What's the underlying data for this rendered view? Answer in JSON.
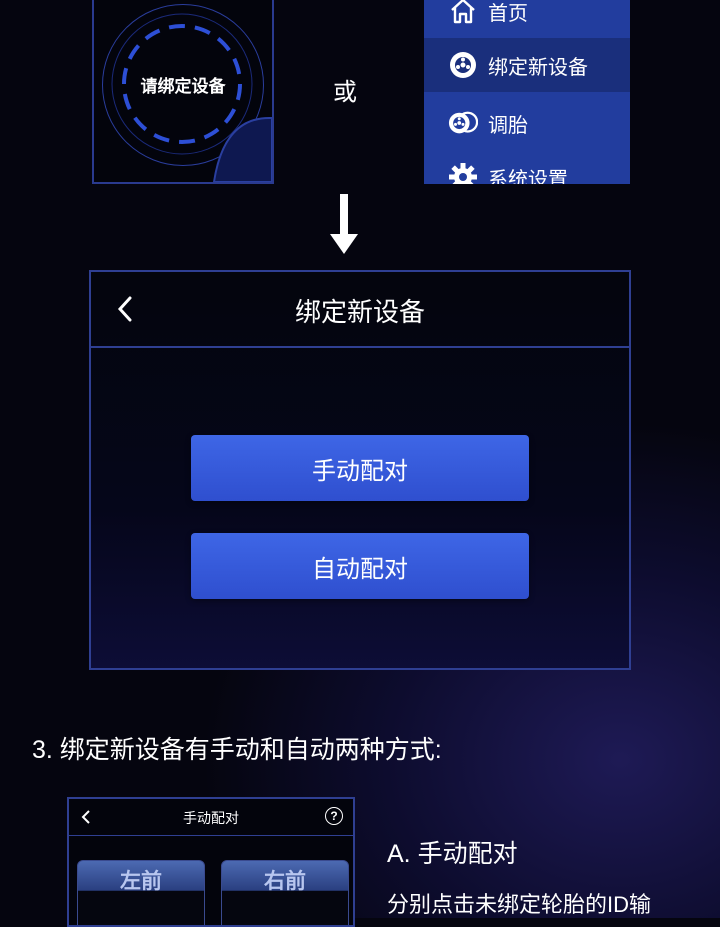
{
  "top_left_screen": {
    "bind_label": "请绑定设备"
  },
  "or_text": "或",
  "menu": {
    "items": [
      {
        "label": "首页",
        "icon": "home-icon"
      },
      {
        "label": "绑定新设备",
        "icon": "tire-icon"
      },
      {
        "label": "调胎",
        "icon": "swap-tires-icon"
      },
      {
        "label": "系统设置",
        "icon": "gear-icon"
      }
    ],
    "active_index": 1
  },
  "bind_panel": {
    "title": "绑定新设备",
    "manual_button": "手动配对",
    "auto_button": "自动配对"
  },
  "section_heading": "3. 绑定新设备有手动和自动两种方式:",
  "mini_screen": {
    "title": "手动配对",
    "help_glyph": "?",
    "tires": [
      {
        "label": "左前"
      },
      {
        "label": "右前"
      }
    ]
  },
  "option_a": {
    "title": "A. 手动配对",
    "description": "分别点击未绑定轮胎的ID输"
  },
  "colors": {
    "accent": "#3e66e6",
    "menu_bg": "#223d9e",
    "border": "#2f3f92"
  }
}
